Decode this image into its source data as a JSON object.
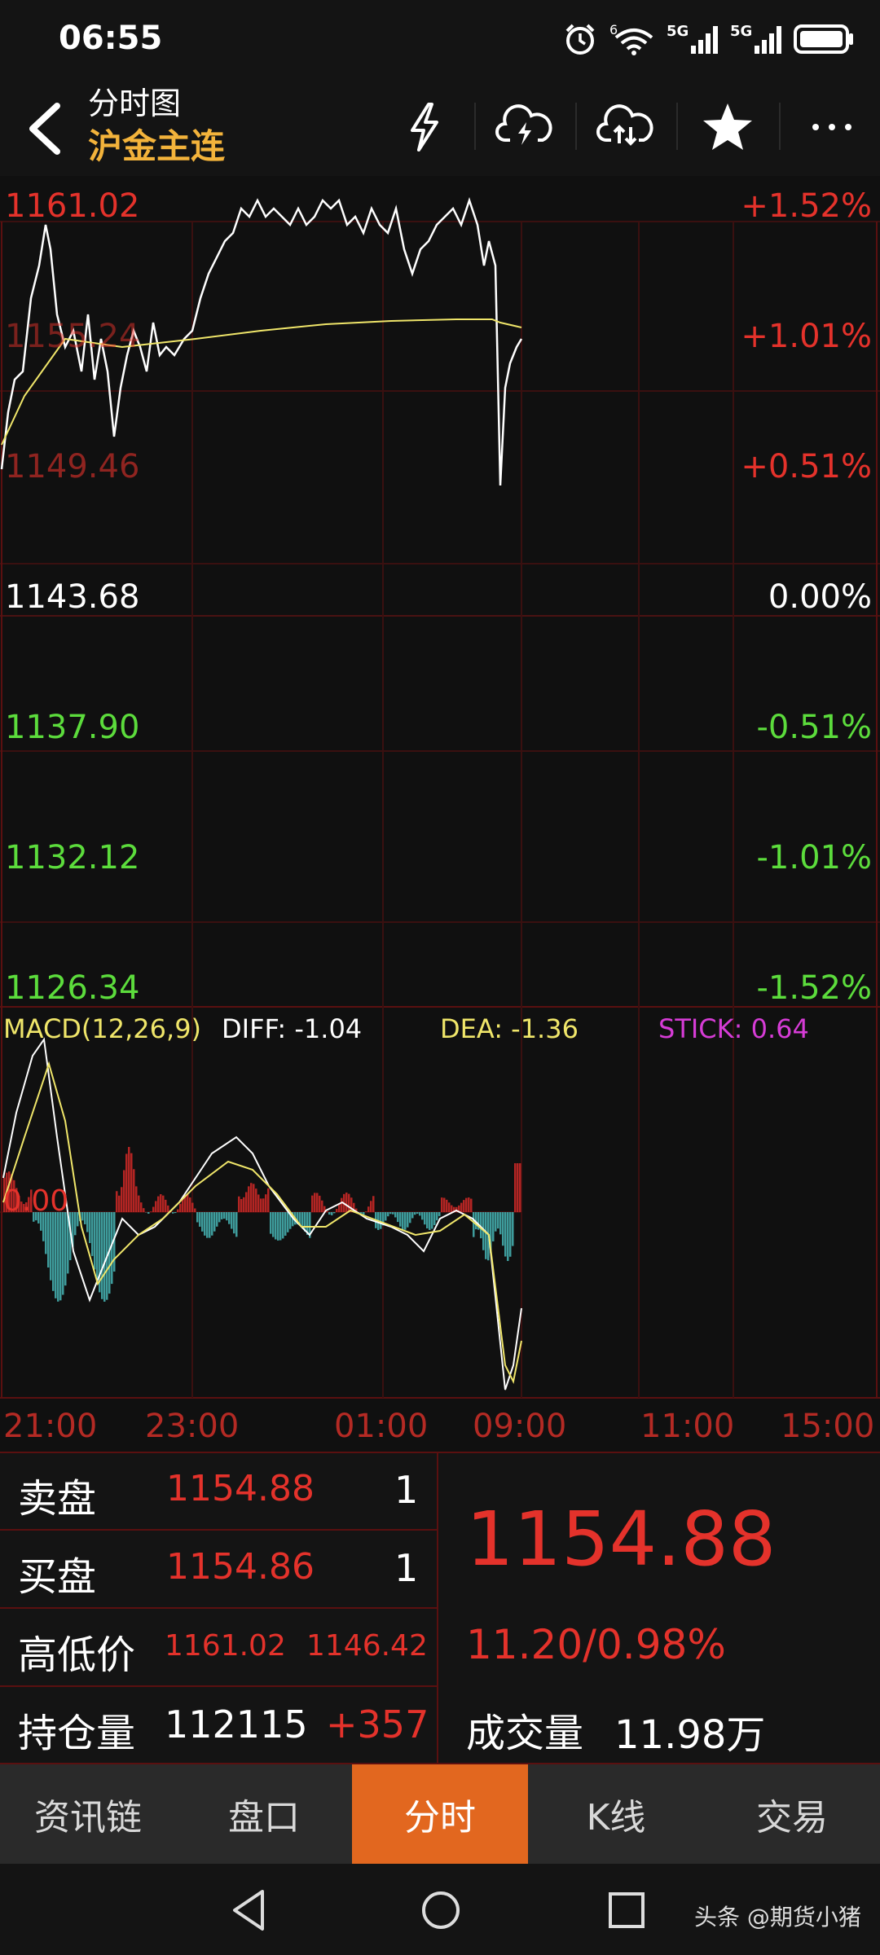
{
  "status": {
    "time": "06:55",
    "network1": "5G",
    "network2": "5G",
    "wifi_badge": "6"
  },
  "header": {
    "title": "分时图",
    "subtitle": "沪金主连"
  },
  "chart": {
    "price_labels": [
      "1161.02",
      "1155.24",
      "1149.46",
      "1143.68",
      "1137.90",
      "1132.12",
      "1126.34"
    ],
    "pct_labels": [
      "+1.52%",
      "+1.01%",
      "+0.51%",
      "0.00%",
      "-0.51%",
      "-1.01%",
      "-1.52%"
    ],
    "macd_label": "MACD(12,26,9)",
    "diff_label": "DIFF: -1.04",
    "dea_label": "DEA: -1.36",
    "stick_label": "STICK: 0.64",
    "zero_label": "0.00",
    "time_labels": [
      "21:00",
      "23:00",
      "01:00",
      "09:00",
      "11:00",
      "15:00"
    ],
    "colors": {
      "up": "#e4322b",
      "down": "#5cdc3c",
      "price_line": "#ffffff",
      "avg_line": "#f0e66a",
      "grid": "#5a1010",
      "stick_pos": "#b42523",
      "stick_neg": "#3e9c9c"
    }
  },
  "quote": {
    "sell_label": "卖盘",
    "sell_price": "1154.88",
    "sell_qty": "1",
    "buy_label": "买盘",
    "buy_price": "1154.86",
    "buy_qty": "1",
    "hl_label": "高低价",
    "high": "1161.02",
    "low": "1146.42",
    "oi_label": "持仓量",
    "oi_value": "112115",
    "oi_change": "+357",
    "last_price": "1154.88",
    "change": "11.20/0.98%",
    "volume_label": "成交量",
    "volume_value": "11.98万"
  },
  "tabs": [
    "资讯链",
    "盘口",
    "分时",
    "K线",
    "交易"
  ],
  "active_tab": 2,
  "watermark": "头条 @期货小猪"
}
